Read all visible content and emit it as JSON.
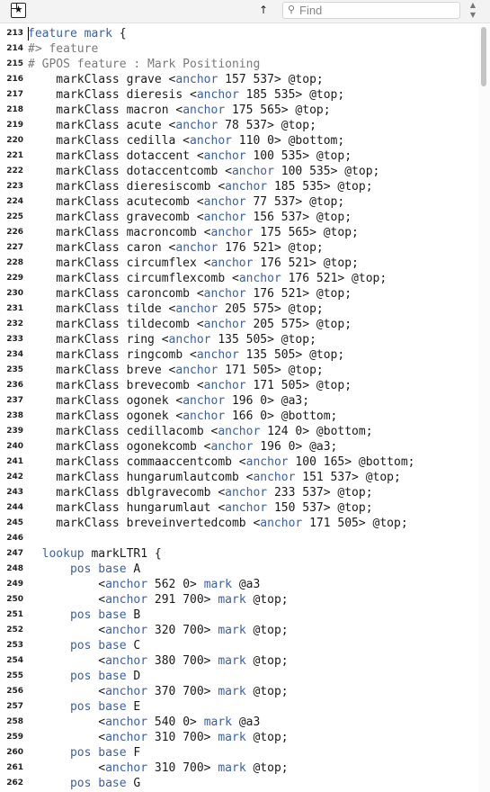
{
  "toolbar": {
    "up_arrow": "↑",
    "find_placeholder": "Find",
    "find_value": "",
    "search_icon": "search-icon",
    "file_icon": "star-document-icon"
  },
  "editor": {
    "colors": {
      "keyword": "#3b5fa8",
      "comment": "#7a7a7a",
      "text": "#1a1a1a"
    },
    "lines": [
      {
        "n": "213",
        "t": "[[feature]] [[mark]] {"
      },
      {
        "n": "214",
        "t": "#> feature"
      },
      {
        "n": "215",
        "t": "# GPOS feature : Mark Positioning"
      },
      {
        "n": "216",
        "t": "    markClass grave <[[anchor]] 157 537> @top;"
      },
      {
        "n": "217",
        "t": "    markClass dieresis <[[anchor]] 185 535> @top;"
      },
      {
        "n": "218",
        "t": "    markClass macron <[[anchor]] 175 565> @top;"
      },
      {
        "n": "219",
        "t": "    markClass acute <[[anchor]] 78 537> @top;"
      },
      {
        "n": "220",
        "t": "    markClass cedilla <[[anchor]] 110 0> @bottom;"
      },
      {
        "n": "221",
        "t": "    markClass dotaccent <[[anchor]] 100 535> @top;"
      },
      {
        "n": "222",
        "t": "    markClass dotaccentcomb <[[anchor]] 100 535> @top;"
      },
      {
        "n": "223",
        "t": "    markClass dieresiscomb <[[anchor]] 185 535> @top;"
      },
      {
        "n": "224",
        "t": "    markClass acutecomb <[[anchor]] 77 537> @top;"
      },
      {
        "n": "225",
        "t": "    markClass gravecomb <[[anchor]] 156 537> @top;"
      },
      {
        "n": "226",
        "t": "    markClass macroncomb <[[anchor]] 175 565> @top;"
      },
      {
        "n": "227",
        "t": "    markClass caron <[[anchor]] 176 521> @top;"
      },
      {
        "n": "228",
        "t": "    markClass circumflex <[[anchor]] 176 521> @top;"
      },
      {
        "n": "229",
        "t": "    markClass circumflexcomb <[[anchor]] 176 521> @top;"
      },
      {
        "n": "230",
        "t": "    markClass caroncomb <[[anchor]] 176 521> @top;"
      },
      {
        "n": "231",
        "t": "    markClass tilde <[[anchor]] 205 575> @top;"
      },
      {
        "n": "232",
        "t": "    markClass tildecomb <[[anchor]] 205 575> @top;"
      },
      {
        "n": "233",
        "t": "    markClass ring <[[anchor]] 135 505> @top;"
      },
      {
        "n": "234",
        "t": "    markClass ringcomb <[[anchor]] 135 505> @top;"
      },
      {
        "n": "235",
        "t": "    markClass breve <[[anchor]] 171 505> @top;"
      },
      {
        "n": "236",
        "t": "    markClass brevecomb <[[anchor]] 171 505> @top;"
      },
      {
        "n": "237",
        "t": "    markClass ogonek <[[anchor]] 196 0> @a3;"
      },
      {
        "n": "238",
        "t": "    markClass ogonek <[[anchor]] 166 0> @bottom;"
      },
      {
        "n": "239",
        "t": "    markClass cedillacomb <[[anchor]] 124 0> @bottom;"
      },
      {
        "n": "240",
        "t": "    markClass ogonekcomb <[[anchor]] 196 0> @a3;"
      },
      {
        "n": "241",
        "t": "    markClass commaaccentcomb <[[anchor]] 100 165> @bottom;"
      },
      {
        "n": "242",
        "t": "    markClass hungarumlautcomb <[[anchor]] 151 537> @top;"
      },
      {
        "n": "243",
        "t": "    markClass dblgravecomb <[[anchor]] 233 537> @top;"
      },
      {
        "n": "244",
        "t": "    markClass hungarumlaut <[[anchor]] 150 537> @top;"
      },
      {
        "n": "245",
        "t": "    markClass breveinvertedcomb <[[anchor]] 171 505> @top;"
      },
      {
        "n": "246",
        "t": ""
      },
      {
        "n": "247",
        "t": "  [[lookup]] markLTR1 {"
      },
      {
        "n": "248",
        "t": "      [[pos]] [[base]] A"
      },
      {
        "n": "249",
        "t": "          <[[anchor]] 562 0> [[mark]] @a3"
      },
      {
        "n": "250",
        "t": "          <[[anchor]] 291 700> [[mark]] @top;"
      },
      {
        "n": "251",
        "t": "      [[pos]] [[base]] B"
      },
      {
        "n": "252",
        "t": "          <[[anchor]] 320 700> [[mark]] @top;"
      },
      {
        "n": "253",
        "t": "      [[pos]] [[base]] C"
      },
      {
        "n": "254",
        "t": "          <[[anchor]] 380 700> [[mark]] @top;"
      },
      {
        "n": "255",
        "t": "      [[pos]] [[base]] D"
      },
      {
        "n": "256",
        "t": "          <[[anchor]] 370 700> [[mark]] @top;"
      },
      {
        "n": "257",
        "t": "      [[pos]] [[base]] E"
      },
      {
        "n": "258",
        "t": "          <[[anchor]] 540 0> [[mark]] @a3"
      },
      {
        "n": "259",
        "t": "          <[[anchor]] 310 700> [[mark]] @top;"
      },
      {
        "n": "260",
        "t": "      [[pos]] [[base]] F"
      },
      {
        "n": "261",
        "t": "          <[[anchor]] 310 700> [[mark]] @top;"
      },
      {
        "n": "262",
        "t": "      [[pos]] [[base]] G"
      }
    ]
  }
}
